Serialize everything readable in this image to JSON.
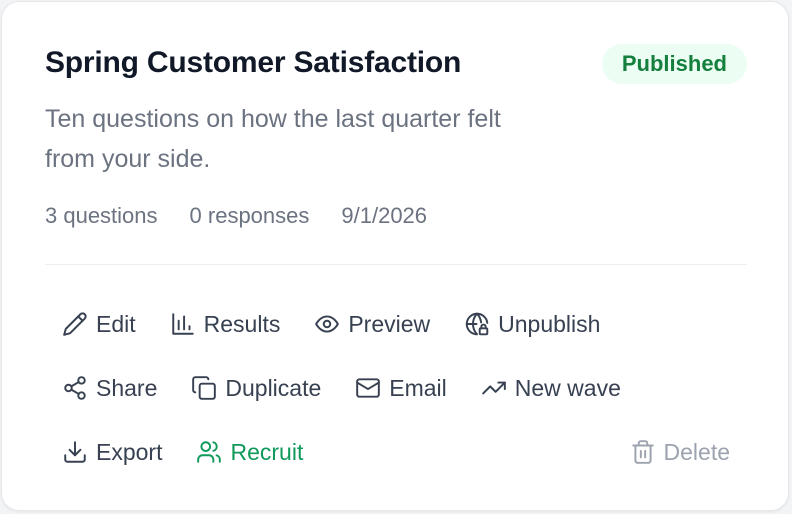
{
  "survey": {
    "title": "Spring Customer Satisfaction",
    "status": "Published",
    "description": "Ten questions on how the last quarter felt from your side.",
    "meta": {
      "questions": "3 questions",
      "responses": "0 responses",
      "date": "9/1/2026"
    }
  },
  "actions": {
    "edit": "Edit",
    "results": "Results",
    "preview": "Preview",
    "unpublish": "Unpublish",
    "share": "Share",
    "duplicate": "Duplicate",
    "email": "Email",
    "new_wave": "New wave",
    "export": "Export",
    "recruit": "Recruit",
    "delete": "Delete"
  },
  "colors": {
    "badge_bg": "#ecfdf3",
    "badge_text": "#15803d",
    "recruit": "#0f9a5b",
    "disabled": "#9ca3af"
  }
}
